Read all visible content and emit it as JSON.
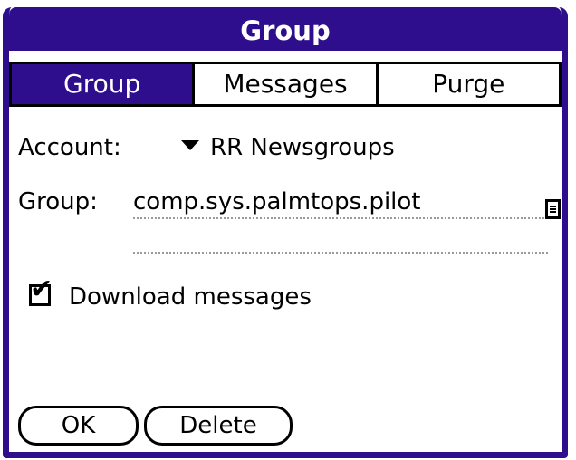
{
  "window": {
    "title": "Group"
  },
  "tabs": [
    {
      "label": "Group",
      "active": true
    },
    {
      "label": "Messages",
      "active": false
    },
    {
      "label": "Purge",
      "active": false
    }
  ],
  "account": {
    "label": "Account:",
    "value": "RR Newsgroups"
  },
  "group": {
    "label": "Group:",
    "value": "comp.sys.palmtops.pilot"
  },
  "options": {
    "download_label": "Download messages",
    "download_checked": true,
    "check_glyph": "✔"
  },
  "buttons": {
    "ok_label": "OK",
    "delete_label": "Delete"
  },
  "icons": {
    "dropdown": "triangle-down-icon",
    "note": "note-icon",
    "checkbox": "checkbox-icon"
  },
  "colors": {
    "title_bg": "#2e0e8c",
    "title_text": "#ffffff",
    "frame": "#2e0e8c"
  }
}
